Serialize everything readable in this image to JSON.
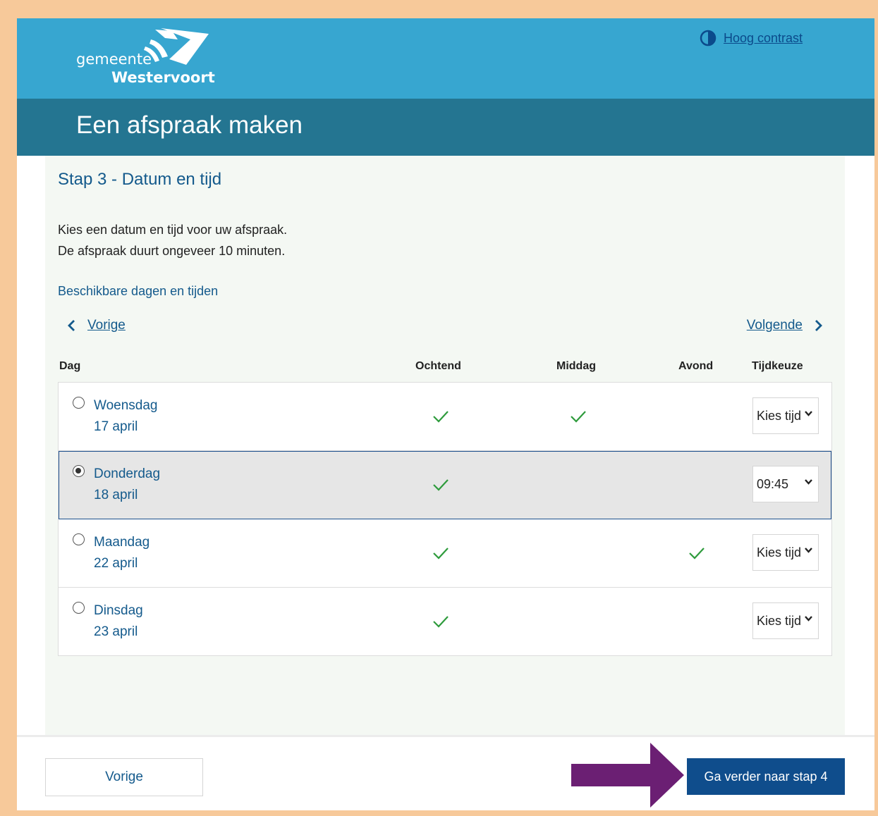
{
  "header": {
    "logo_line1": "gemeente",
    "logo_line2": "Westervoort",
    "contrast_link": "Hoog contrast"
  },
  "page_title": "Een afspraak maken",
  "step_title": "Stap 3 - Datum en tijd",
  "intro_line1": "Kies een datum en tijd voor uw afspraak.",
  "intro_line2": "De afspraak duurt ongeveer 10 minuten.",
  "available_label": "Beschikbare dagen en tijden",
  "nav": {
    "prev": "Vorige",
    "next": "Volgende"
  },
  "columns": {
    "day": "Dag",
    "morning": "Ochtend",
    "afternoon": "Middag",
    "evening": "Avond",
    "time": "Tijdkeuze"
  },
  "rows": [
    {
      "day": "Woensdag",
      "date": "17 april",
      "morning": true,
      "afternoon": true,
      "evening": false,
      "time": "Kies tijd",
      "selected": false
    },
    {
      "day": "Donderdag",
      "date": "18 april",
      "morning": true,
      "afternoon": false,
      "evening": false,
      "time": "09:45",
      "selected": true
    },
    {
      "day": "Maandag",
      "date": "22 april",
      "morning": true,
      "afternoon": false,
      "evening": true,
      "time": "Kies tijd",
      "selected": false
    },
    {
      "day": "Dinsdag",
      "date": "23 april",
      "morning": true,
      "afternoon": false,
      "evening": false,
      "time": "Kies tijd",
      "selected": false
    }
  ],
  "footer": {
    "prev_button": "Vorige",
    "next_button": "Ga verder naar stap 4"
  },
  "colors": {
    "topbar": "#37a6d0",
    "titlebar": "#247591",
    "primary_button": "#0f4d8c",
    "check": "#2e9b3c",
    "annotation_arrow": "#6b1f73"
  }
}
